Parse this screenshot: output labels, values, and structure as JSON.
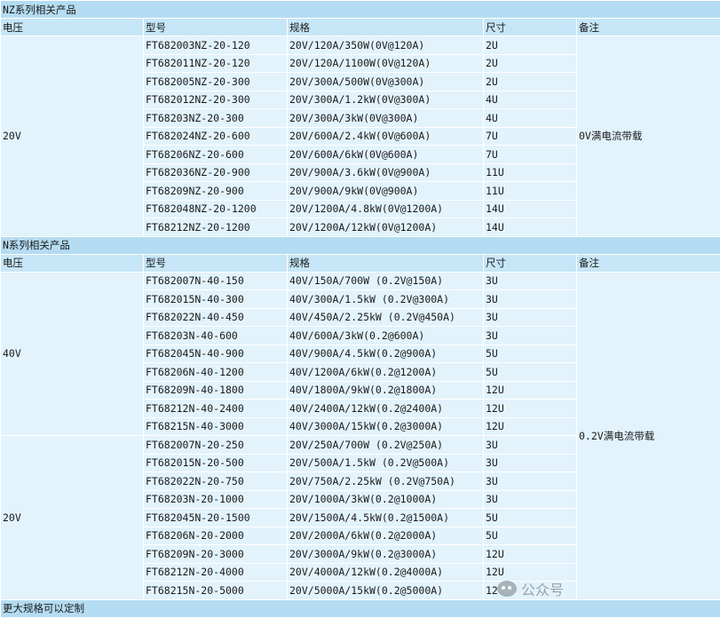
{
  "nz": {
    "section_title": "NZ系列相关产品",
    "headers": {
      "voltage": "电压",
      "model": "型号",
      "spec": "规格",
      "size": "尺寸",
      "note": "备注"
    },
    "voltage": "20V",
    "note": "0V满电流带载",
    "rows": [
      {
        "model": "FT682003NZ-20-120",
        "spec": "20V/120A/350W(0V@120A)",
        "size": "2U"
      },
      {
        "model": "FT682011NZ-20-120",
        "spec": "20V/120A/1100W(0V@120A)",
        "size": "2U"
      },
      {
        "model": "FT682005NZ-20-300",
        "spec": "20V/300A/500W(0V@300A)",
        "size": "2U"
      },
      {
        "model": "FT682012NZ-20-300",
        "spec": "20V/300A/1.2kW(0V@300A)",
        "size": "4U"
      },
      {
        "model": "FT68203NZ-20-300",
        "spec": "20V/300A/3kW(0V@300A)",
        "size": "4U"
      },
      {
        "model": "FT682024NZ-20-600",
        "spec": "20V/600A/2.4kW(0V@600A)",
        "size": "7U"
      },
      {
        "model": "FT68206NZ-20-600",
        "spec": "20V/600A/6kW(0V@600A)",
        "size": "7U"
      },
      {
        "model": "FT682036NZ-20-900",
        "spec": "20V/900A/3.6kW(0V@900A)",
        "size": "11U"
      },
      {
        "model": "FT68209NZ-20-900",
        "spec": "20V/900A/9kW(0V@900A)",
        "size": "11U"
      },
      {
        "model": "FT682048NZ-20-1200",
        "spec": "20V/1200A/4.8kW(0V@1200A)",
        "size": "14U"
      },
      {
        "model": "FT68212NZ-20-1200",
        "spec": "20V/1200A/12kW(0V@1200A)",
        "size": "14U"
      }
    ]
  },
  "n": {
    "section_title": "N系列相关产品",
    "headers": {
      "voltage": "电压",
      "model": "型号",
      "spec": "规格",
      "size": "尺寸",
      "note": "备注"
    },
    "note": "0.2V满电流带载",
    "groups": [
      {
        "voltage": "40V",
        "rows": [
          {
            "model": "FT682007N-40-150",
            "spec": "40V/150A/700W (0.2V@150A)",
            "size": "3U"
          },
          {
            "model": "FT682015N-40-300",
            "spec": "40V/300A/1.5kW (0.2V@300A)",
            "size": "3U"
          },
          {
            "model": "FT682022N-40-450",
            "spec": "40V/450A/2.25kW (0.2V@450A)",
            "size": "3U"
          },
          {
            "model": "FT68203N-40-600",
            "spec": "40V/600A/3kW(0.2@600A)",
            "size": "3U"
          },
          {
            "model": "FT682045N-40-900",
            "spec": "40V/900A/4.5kW(0.2@900A)",
            "size": "5U"
          },
          {
            "model": "FT68206N-40-1200",
            "spec": "40V/1200A/6kW(0.2@1200A)",
            "size": "5U"
          },
          {
            "model": "FT68209N-40-1800",
            "spec": "40V/1800A/9kW(0.2@1800A)",
            "size": "12U"
          },
          {
            "model": "FT68212N-40-2400",
            "spec": "40V/2400A/12kW(0.2@2400A)",
            "size": "12U"
          },
          {
            "model": "FT68215N-40-3000",
            "spec": "40V/3000A/15kW(0.2@3000A)",
            "size": "12U"
          }
        ]
      },
      {
        "voltage": "20V",
        "rows": [
          {
            "model": "FT682007N-20-250",
            "spec": "20V/250A/700W (0.2V@250A)",
            "size": "3U"
          },
          {
            "model": "FT682015N-20-500",
            "spec": "20V/500A/1.5kW (0.2V@500A)",
            "size": "3U"
          },
          {
            "model": "FT682022N-20-750",
            "spec": "20V/750A/2.25kW (0.2V@750A)",
            "size": "3U"
          },
          {
            "model": "FT68203N-20-1000",
            "spec": "20V/1000A/3kW(0.2@1000A)",
            "size": "3U"
          },
          {
            "model": "FT682045N-20-1500",
            "spec": "20V/1500A/4.5kW(0.2@1500A)",
            "size": "5U"
          },
          {
            "model": "FT68206N-20-2000",
            "spec": "20V/2000A/6kW(0.2@2000A)",
            "size": "5U"
          },
          {
            "model": "FT68209N-20-3000",
            "spec": "20V/3000A/9kW(0.2@3000A)",
            "size": "12U"
          },
          {
            "model": "FT68212N-20-4000",
            "spec": "20V/4000A/12kW(0.2@4000A)",
            "size": "12U"
          },
          {
            "model": "FT68215N-20-5000",
            "spec": "20V/5000A/15kW(0.2@5000A)",
            "size": "12U"
          }
        ]
      }
    ]
  },
  "footer": "更大规格可以定制",
  "watermark": "公众号"
}
